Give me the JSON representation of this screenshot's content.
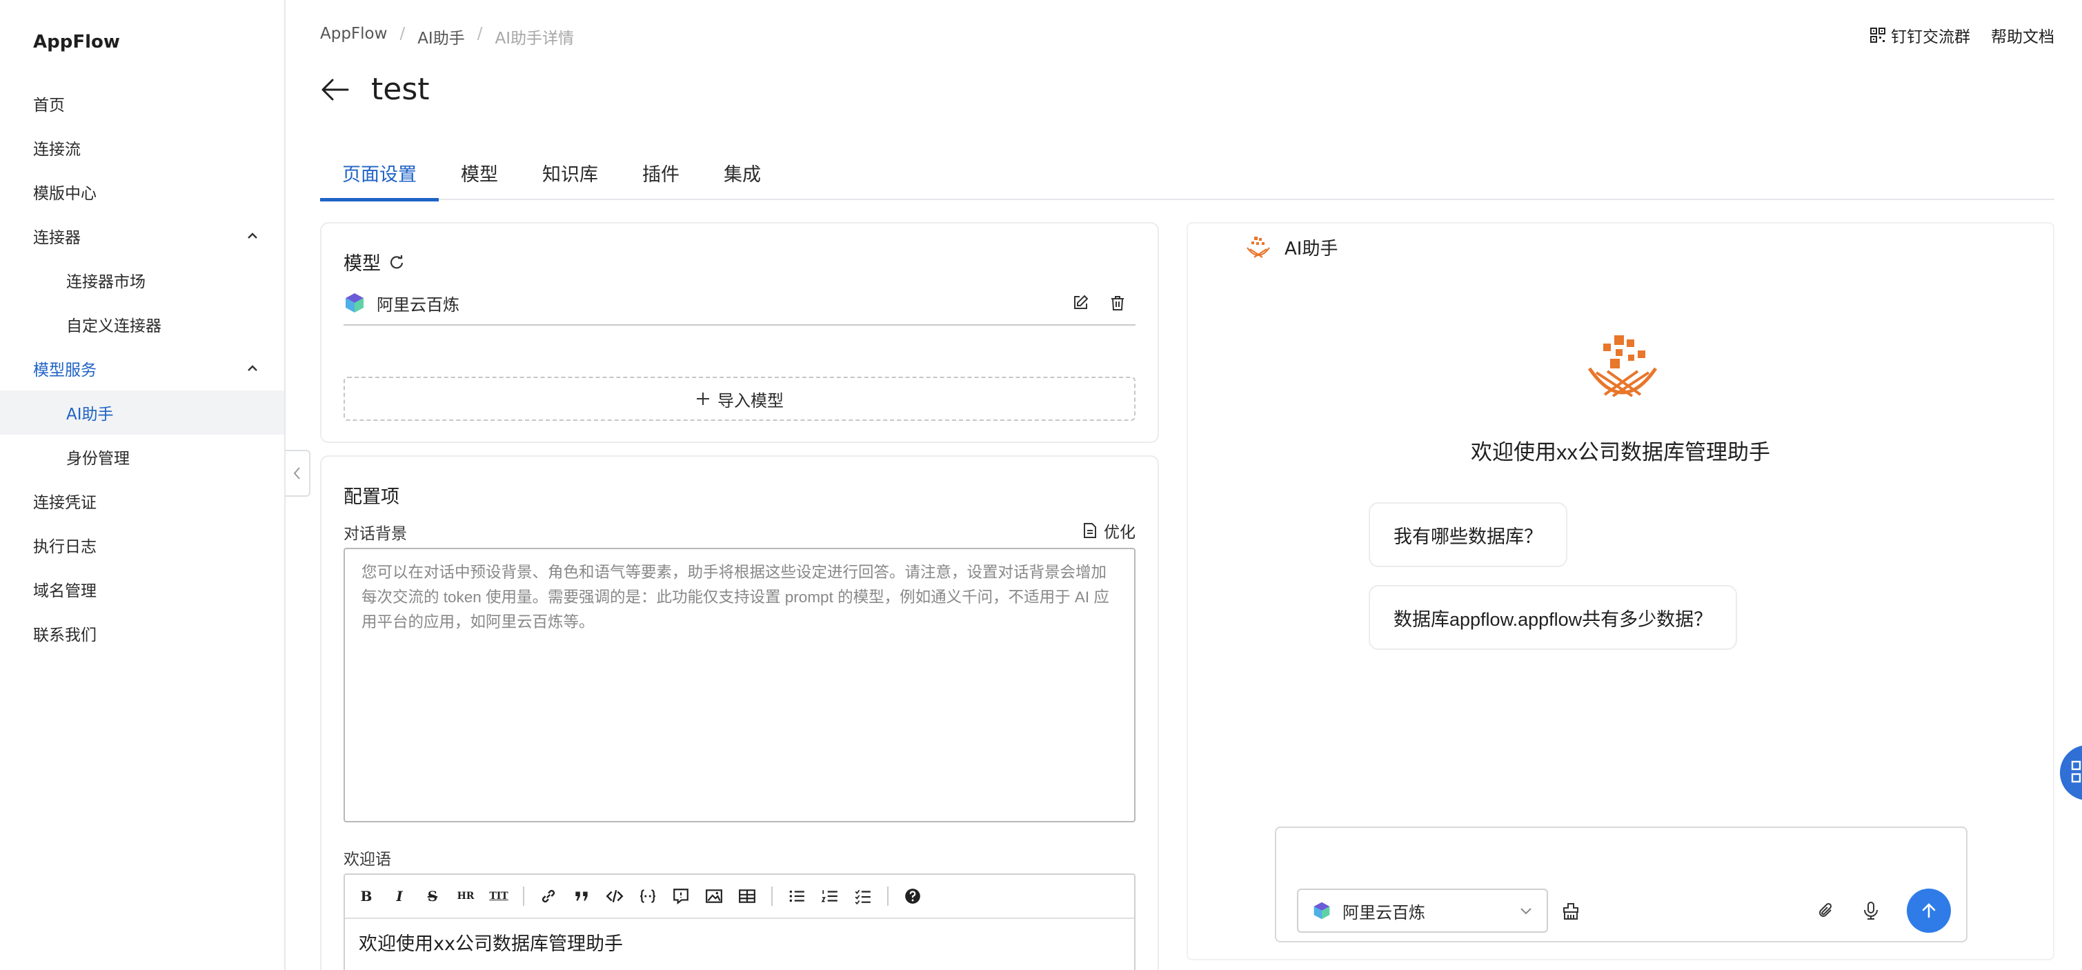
{
  "app": {
    "name": "AppFlow"
  },
  "sidebar": {
    "items": [
      {
        "label": "首页"
      },
      {
        "label": "连接流"
      },
      {
        "label": "模版中心"
      },
      {
        "label": "连接器"
      },
      {
        "label": "连接器市场"
      },
      {
        "label": "自定义连接器"
      },
      {
        "label": "模型服务"
      },
      {
        "label": "AI助手"
      },
      {
        "label": "身份管理"
      },
      {
        "label": "连接凭证"
      },
      {
        "label": "执行日志"
      },
      {
        "label": "域名管理"
      },
      {
        "label": "联系我们"
      }
    ]
  },
  "breadcrumb": {
    "items": [
      "AppFlow",
      "AI助手",
      "AI助手详情"
    ],
    "separator": "/"
  },
  "header": {
    "links": [
      "钉钉交流群",
      "帮助文档"
    ]
  },
  "page": {
    "title": "test"
  },
  "tabs": [
    {
      "label": "页面设置",
      "active": true
    },
    {
      "label": "模型"
    },
    {
      "label": "知识库"
    },
    {
      "label": "插件"
    },
    {
      "label": "集成"
    }
  ],
  "model_card": {
    "title": "模型",
    "model_name": "阿里云百炼",
    "import_label": "导入模型"
  },
  "config_card": {
    "title": "配置项",
    "background_label": "对话背景",
    "optimize_label": "优化",
    "background_placeholder": "您可以在对话中预设背景、角色和语气等要素，助手将根据这些设定进行回答。请注意，设置对话背景会增加每次交流的 token 使用量。需要强调的是：此功能仅支持设置 prompt 的模型，例如通义千问，不适用于 AI 应用平台的应用，如阿里云百炼等。",
    "welcome_label": "欢迎语",
    "welcome_value": "欢迎使用xx公司数据库管理助手"
  },
  "chat": {
    "title": "AI助手",
    "welcome": "欢迎使用xx公司数据库管理助手",
    "suggestions": [
      "我有哪些数据库？",
      "数据库appflow.appflow共有多少数据？"
    ],
    "model_select": "阿里云百炼"
  },
  "colors": {
    "accent": "#1f63c6",
    "brand_orange": "#e8762b",
    "send": "#2f7ce8"
  }
}
